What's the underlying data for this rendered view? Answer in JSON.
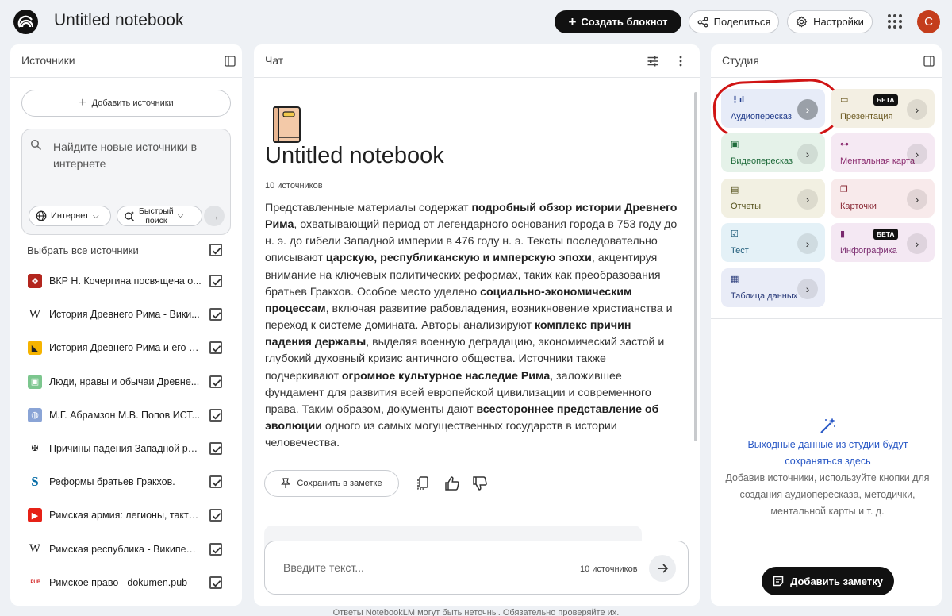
{
  "header": {
    "title": "Untitled notebook",
    "create_label": "Создать блокнот",
    "share_label": "Поделиться",
    "settings_label": "Настройки",
    "avatar_letter": "С"
  },
  "sources": {
    "title": "Источники",
    "add_label": "Добавить источники",
    "search_placeholder": "Найдите новые источники в интернете",
    "web_chip": "Интернет",
    "fast_chip_line1": "Быстрый",
    "fast_chip_line2": "поиск",
    "select_all": "Выбрать все источники",
    "items": [
      {
        "label": "ВКР Н. Кочергина посвящена о...",
        "icon": "document-red-icon",
        "checked": true
      },
      {
        "label": "История Древнего Рима - Вики...",
        "icon": "wikipedia-icon",
        "checked": true
      },
      {
        "label": "История Древнего Рима и его п...",
        "icon": "yellow-site-icon",
        "checked": true
      },
      {
        "label": "Люди, нравы и обычаи Древне...",
        "icon": "green-book-icon",
        "checked": true
      },
      {
        "label": "М.Г. Абрамзон М.В. Попов ИСТ...",
        "icon": "globe-icon",
        "checked": true
      },
      {
        "label": "Причины падения Западной ри...",
        "icon": "emblem-icon",
        "checked": true
      },
      {
        "label": "Реформы братьев Гракхов.",
        "icon": "s-logo-icon",
        "checked": true
      },
      {
        "label": "Римская армия: легионы, такти...",
        "icon": "youtube-icon",
        "checked": true
      },
      {
        "label": "Римская республика - Википедия",
        "icon": "wikipedia-icon",
        "checked": true
      },
      {
        "label": "Римское право - dokumen.pub",
        "icon": "pub-icon",
        "checked": true
      }
    ]
  },
  "chat": {
    "title": "Чат",
    "notebook_title": "Untitled notebook",
    "source_count": "10 источников",
    "summary": [
      {
        "t": "Представленные материалы содержат ",
        "b": false
      },
      {
        "t": "подробный обзор истории Древнего Рима",
        "b": true
      },
      {
        "t": ", охватывающий период от легендарного основания города в 753 году до н. э. до гибели Западной империи в 476 году н. э. Тексты последовательно описывают ",
        "b": false
      },
      {
        "t": "царскую, республиканскую и имперскую эпохи",
        "b": true
      },
      {
        "t": ", акцентируя внимание на ключевых политических реформах, таких как преобразования братьев Гракхов. Особое место уделено ",
        "b": false
      },
      {
        "t": "социально-экономическим процессам",
        "b": true
      },
      {
        "t": ", включая развитие рабовладения, возникновение христианства и переход к системе домината. Авторы анализируют ",
        "b": false
      },
      {
        "t": "комплекс причин падения державы",
        "b": true
      },
      {
        "t": ", выделяя военную деградацию, экономический застой и глубокий духовный кризис античного общества. Источники также подчеркивают ",
        "b": false
      },
      {
        "t": "огромное культурное наследие Рима",
        "b": true
      },
      {
        "t": ", заложившее фундамент для развития всей европейской цивилизации и современного права. Таким образом, документы дают ",
        "b": false
      },
      {
        "t": "всестороннее представление об эволюции",
        "b": true
      },
      {
        "t": " одного из самых могущественных государств в истории человечества.",
        "b": false
      }
    ],
    "save_note_label": "Сохранить в заметке",
    "input_placeholder": "Введите текст...",
    "input_source_count": "10 источников"
  },
  "studio": {
    "title": "Студия",
    "tiles": [
      {
        "label": "Аудиопересказ",
        "icon": "audio-waveform-icon",
        "bg": "#e7ecf8",
        "color": "#1f3a8a",
        "beta": false
      },
      {
        "label": "Презентация",
        "icon": "slides-icon",
        "bg": "#f3efe3",
        "color": "#6b5a22",
        "beta": true
      },
      {
        "label": "Видеопересказ",
        "icon": "video-icon",
        "bg": "#e5f2e9",
        "color": "#1f6b3b",
        "beta": false
      },
      {
        "label": "Ментальная карта",
        "icon": "mindmap-icon",
        "bg": "#f5e9f3",
        "color": "#8a2a6e",
        "beta": false
      },
      {
        "label": "Отчеты",
        "icon": "reports-icon",
        "bg": "#f2f0e2",
        "color": "#55521c",
        "beta": false
      },
      {
        "label": "Карточки",
        "icon": "flashcards-icon",
        "bg": "#f8eaeb",
        "color": "#8a2a36",
        "beta": false
      },
      {
        "label": "Тест",
        "icon": "quiz-icon",
        "bg": "#e4f1f7",
        "color": "#1d5a78",
        "beta": false
      },
      {
        "label": "Инфографика",
        "icon": "infographic-icon",
        "bg": "#f4e8f3",
        "color": "#7a2a6e",
        "beta": true
      },
      {
        "label": "Таблица данных",
        "icon": "table-icon",
        "bg": "#e9ecf7",
        "color": "#2a3b7a",
        "beta": false
      }
    ],
    "beta_label": "БЕТА",
    "empty_title": "Выходные данные из студии будут сохраняться здесь",
    "empty_desc": "Добавив источники, используйте кнопки для создания аудиопересказа, методички, ментальной карты и т. д.",
    "add_note_label": "Добавить заметку"
  },
  "footer": {
    "disclaimer": "Ответы NotebookLM могут быть неточны. Обязательно проверяйте их."
  }
}
